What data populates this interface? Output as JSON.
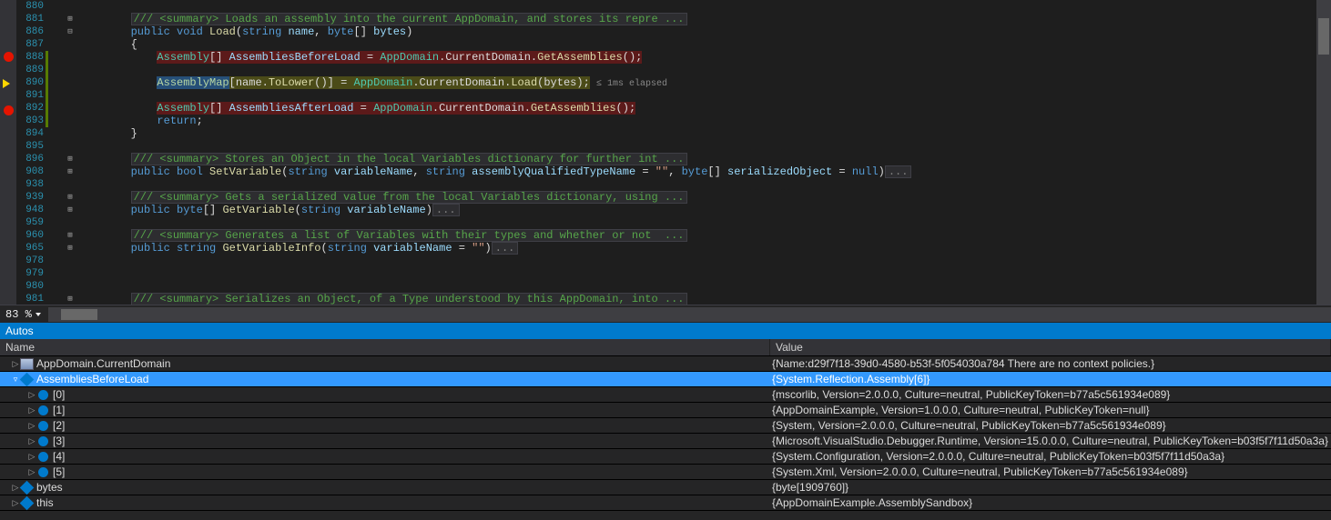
{
  "editor": {
    "zoom": "83 %",
    "lines": [
      {
        "n": "880",
        "fold": "",
        "bp": "",
        "arrow": "",
        "chg": false
      },
      {
        "n": "881",
        "fold": "+",
        "bp": "",
        "arrow": "",
        "chg": false,
        "comment": "/// <summary> Loads an assembly into the current AppDomain, and stores its repre ..."
      },
      {
        "n": "886",
        "fold": "-",
        "bp": "",
        "arrow": "",
        "chg": false,
        "sigHtml": "<span class='kw'>public</span> <span class='kw'>void</span> <span class='fn'>Load</span>(<span class='kw'>string</span> <span class='var'>name</span>, <span class='kw'>byte</span>[] <span class='var'>bytes</span>)"
      },
      {
        "n": "887",
        "fold": "",
        "bp": "",
        "arrow": "",
        "chg": false,
        "plain": "{"
      },
      {
        "n": "888",
        "fold": "",
        "bp": "dot",
        "arrow": "",
        "chg": true,
        "hl": "bp",
        "codeHtml": "<span class='typ'>Assembly</span>[] <span class='var'>AssembliesBeforeLoad</span> = <span class='typ'>AppDomain</span>.CurrentDomain.<span class='fn'>GetAssemblies</span>();"
      },
      {
        "n": "889",
        "fold": "",
        "bp": "",
        "arrow": "",
        "chg": true,
        "plain": ""
      },
      {
        "n": "890",
        "fold": "",
        "bp": "",
        "arrow": "y",
        "chg": true,
        "hl": "cur",
        "codeHtml": "<span class='hl-sel'><span class='asm'>AssemblyMap</span></span>[name.<span class='fn'>ToLower</span>()] = <span class='typ'>AppDomain</span>.CurrentDomain.<span class='fn'>Load</span>(bytes);",
        "timing": "≤ 1ms elapsed"
      },
      {
        "n": "891",
        "fold": "",
        "bp": "",
        "arrow": "",
        "chg": true,
        "plain": ""
      },
      {
        "n": "892",
        "fold": "",
        "bp": "dot",
        "arrow": "",
        "chg": true,
        "hl": "bp",
        "codeHtml": "<span class='typ'>Assembly</span>[] <span class='var'>AssembliesAfterLoad</span> = <span class='typ'>AppDomain</span>.CurrentDomain.<span class='fn'>GetAssemblies</span>();"
      },
      {
        "n": "893",
        "fold": "",
        "bp": "",
        "arrow": "",
        "chg": true,
        "codeHtml": "<span class='kw'>return</span>;"
      },
      {
        "n": "894",
        "fold": "",
        "bp": "",
        "arrow": "",
        "chg": false,
        "plain": "}"
      },
      {
        "n": "895",
        "fold": "",
        "bp": "",
        "arrow": "",
        "chg": false,
        "plain": ""
      },
      {
        "n": "896",
        "fold": "+",
        "bp": "",
        "arrow": "",
        "chg": false,
        "comment": "/// <summary> Stores an Object in the local Variables dictionary for further int ..."
      },
      {
        "n": "908",
        "fold": "+",
        "bp": "",
        "arrow": "",
        "chg": false,
        "sigHtml": "<span class='kw'>public</span> <span class='kw'>bool</span> <span class='fn'>SetVariable</span>(<span class='kw'>string</span> <span class='var'>variableName</span>, <span class='kw'>string</span> <span class='var'>assemblyQualifiedTypeName</span> = <span class='str'>\"\"</span>, <span class='kw'>byte</span>[] <span class='var'>serializedObject</span> = <span class='kw'>null</span>)",
        "foldbox": true
      },
      {
        "n": "938",
        "fold": "",
        "bp": "",
        "arrow": "",
        "chg": false,
        "plain": ""
      },
      {
        "n": "939",
        "fold": "+",
        "bp": "",
        "arrow": "",
        "chg": false,
        "comment": "/// <summary> Gets a serialized value from the local Variables dictionary, using ..."
      },
      {
        "n": "948",
        "fold": "+",
        "bp": "",
        "arrow": "",
        "chg": false,
        "sigHtml": "<span class='kw'>public</span> <span class='kw'>byte</span>[] <span class='fn'>GetVariable</span>(<span class='kw'>string</span> <span class='var'>variableName</span>)",
        "foldbox": true
      },
      {
        "n": "959",
        "fold": "",
        "bp": "",
        "arrow": "",
        "chg": false,
        "plain": ""
      },
      {
        "n": "960",
        "fold": "+",
        "bp": "",
        "arrow": "",
        "chg": false,
        "comment": "/// <summary> Generates a list of Variables with their types and whether or not  ..."
      },
      {
        "n": "965",
        "fold": "+",
        "bp": "",
        "arrow": "",
        "chg": false,
        "sigHtml": "<span class='kw'>public</span> <span class='kw'>string</span> <span class='fn'>GetVariableInfo</span>(<span class='kw'>string</span> <span class='var'>variableName</span> = <span class='str'>\"\"</span>)",
        "foldbox": true
      },
      {
        "n": "978",
        "fold": "",
        "bp": "",
        "arrow": "",
        "chg": false,
        "plain": ""
      },
      {
        "n": "979",
        "fold": "",
        "bp": "",
        "arrow": "",
        "chg": false,
        "plain": ""
      },
      {
        "n": "980",
        "fold": "",
        "bp": "",
        "arrow": "",
        "chg": false,
        "plain": ""
      },
      {
        "n": "981",
        "fold": "+",
        "bp": "",
        "arrow": "",
        "chg": false,
        "comment": "/// <summary> Serializes an Object, of a Type understood by this AppDomain, into ..."
      }
    ]
  },
  "autos": {
    "title": "Autos",
    "headers": {
      "name": "Name",
      "value": "Value"
    },
    "rows": [
      {
        "depth": 0,
        "tw": "▷",
        "icon": "app",
        "name": "AppDomain.CurrentDomain",
        "value": "{Name:d29f7f18-39d0-4580-b53f-5f054030a784 There are no context policies.}",
        "sel": false
      },
      {
        "depth": 0,
        "tw": "▿",
        "icon": "field",
        "name": "AssembliesBeforeLoad",
        "value": "{System.Reflection.Assembly[6]}",
        "sel": true
      },
      {
        "depth": 1,
        "tw": "▷",
        "icon": "obj",
        "name": "[0]",
        "value": "{mscorlib, Version=2.0.0.0, Culture=neutral, PublicKeyToken=b77a5c561934e089}",
        "sel": false
      },
      {
        "depth": 1,
        "tw": "▷",
        "icon": "obj",
        "name": "[1]",
        "value": "{AppDomainExample, Version=1.0.0.0, Culture=neutral, PublicKeyToken=null}",
        "sel": false
      },
      {
        "depth": 1,
        "tw": "▷",
        "icon": "obj",
        "name": "[2]",
        "value": "{System, Version=2.0.0.0, Culture=neutral, PublicKeyToken=b77a5c561934e089}",
        "sel": false
      },
      {
        "depth": 1,
        "tw": "▷",
        "icon": "obj",
        "name": "[3]",
        "value": "{Microsoft.VisualStudio.Debugger.Runtime, Version=15.0.0.0, Culture=neutral, PublicKeyToken=b03f5f7f11d50a3a}",
        "sel": false
      },
      {
        "depth": 1,
        "tw": "▷",
        "icon": "obj",
        "name": "[4]",
        "value": "{System.Configuration, Version=2.0.0.0, Culture=neutral, PublicKeyToken=b03f5f7f11d50a3a}",
        "sel": false
      },
      {
        "depth": 1,
        "tw": "▷",
        "icon": "obj",
        "name": "[5]",
        "value": "{System.Xml, Version=2.0.0.0, Culture=neutral, PublicKeyToken=b77a5c561934e089}",
        "sel": false
      },
      {
        "depth": 0,
        "tw": "▷",
        "icon": "field",
        "name": "bytes",
        "value": "{byte[1909760]}",
        "sel": false
      },
      {
        "depth": 0,
        "tw": "▷",
        "icon": "field",
        "name": "this",
        "value": "{AppDomainExample.AssemblySandbox}",
        "sel": false
      }
    ]
  }
}
